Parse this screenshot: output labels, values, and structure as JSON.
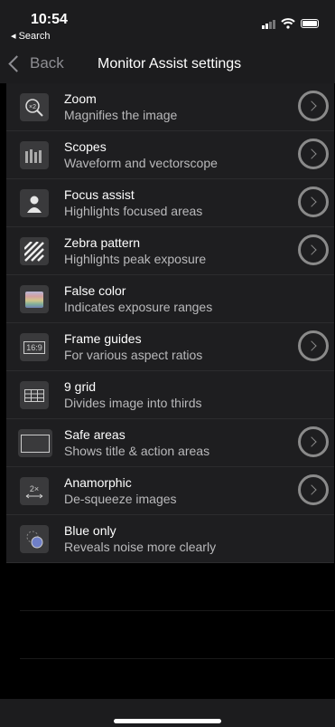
{
  "status": {
    "time": "10:54",
    "back_app": "◂ Search"
  },
  "nav": {
    "back_label": "Back",
    "title": "Monitor Assist settings"
  },
  "items": [
    {
      "label": "Zoom",
      "sub": "Magnifies the image",
      "icon": "zoom-icon",
      "glyph": "×2",
      "has_arrow": true
    },
    {
      "label": "Scopes",
      "sub": "Waveform and vectorscope",
      "icon": "scopes-icon",
      "glyph": "",
      "has_arrow": true
    },
    {
      "label": "Focus assist",
      "sub": "Highlights focused areas",
      "icon": "focus-person-icon",
      "glyph": "",
      "has_arrow": true
    },
    {
      "label": "Zebra pattern",
      "sub": "Highlights peak exposure",
      "icon": "zebra-icon",
      "glyph": "",
      "has_arrow": true
    },
    {
      "label": "False color",
      "sub": "Indicates exposure ranges",
      "icon": "false-color-icon",
      "glyph": "",
      "has_arrow": false
    },
    {
      "label": "Frame guides",
      "sub": "For various aspect ratios",
      "icon": "frame-guides-icon",
      "glyph": "16:9",
      "has_arrow": true
    },
    {
      "label": "9 grid",
      "sub": "Divides image into thirds",
      "icon": "grid-icon",
      "glyph": "",
      "has_arrow": false
    },
    {
      "label": "Safe areas",
      "sub": "Shows title & action areas",
      "icon": "safe-areas-icon",
      "glyph": "",
      "has_arrow": true
    },
    {
      "label": "Anamorphic",
      "sub": "De-squeeze images",
      "icon": "anamorphic-icon",
      "glyph": "2×",
      "has_arrow": true
    },
    {
      "label": "Blue only",
      "sub": "Reveals noise more clearly",
      "icon": "blue-only-icon",
      "glyph": "",
      "has_arrow": false
    }
  ]
}
